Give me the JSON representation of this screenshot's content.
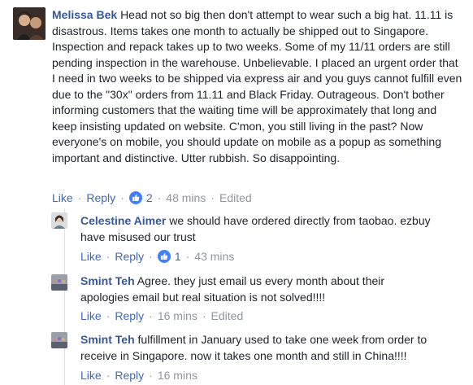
{
  "comments": [
    {
      "author": "Melissa Bek",
      "text": "Head not so big then don't attempt to wear such a big hat. 11.11 is disastrous. Items takes one month to actually be shipped out to Singapore. Inspection and repack takes up to two weeks. Some of my 11/11 orders are still pending inspection in the warehouse. Unbelievable. I placed an urgent order that I need in two weeks to be shipped via express air and you guys cannot fulfill even due to the \"30x\" orders from 11.11 and Black Friday. Outrageous. Don't bother informing customers that the waiting time will be approximately that long and keep insisting updated on website. C'mon, you still living in the past? Now everyone's on mobile, you should update on mobile as a popup as something important and distinctive. Utter rubbish. So disappointing.",
      "like_label": "Like",
      "reply_label": "Reply",
      "likes": "2",
      "time": "48 mins",
      "edited": "Edited"
    },
    {
      "author": "Celestine Aimer",
      "text": "we should have ordered directly from taobao. ezbuy have misused our trust",
      "like_label": "Like",
      "reply_label": "Reply",
      "likes": "1",
      "time": "43 mins"
    },
    {
      "author": "Smint Teh",
      "text": "Agree. they just email us every month about their apologies email but real situation is not solved!!!!",
      "like_label": "Like",
      "reply_label": "Reply",
      "time": "16 mins",
      "edited": "Edited"
    },
    {
      "author": "Smint Teh",
      "text": "fulfillment in January used to take one week from order to receive in Singapore. now it takes one month and still in China!!!!",
      "like_label": "Like",
      "reply_label": "Reply",
      "time": "16 mins"
    }
  ],
  "icons": {
    "like_reaction": "thumbs-up-icon"
  },
  "colors": {
    "author": "#365899",
    "link": "#4267b2",
    "muted": "#90949c",
    "like_badge": "#4080ff"
  }
}
